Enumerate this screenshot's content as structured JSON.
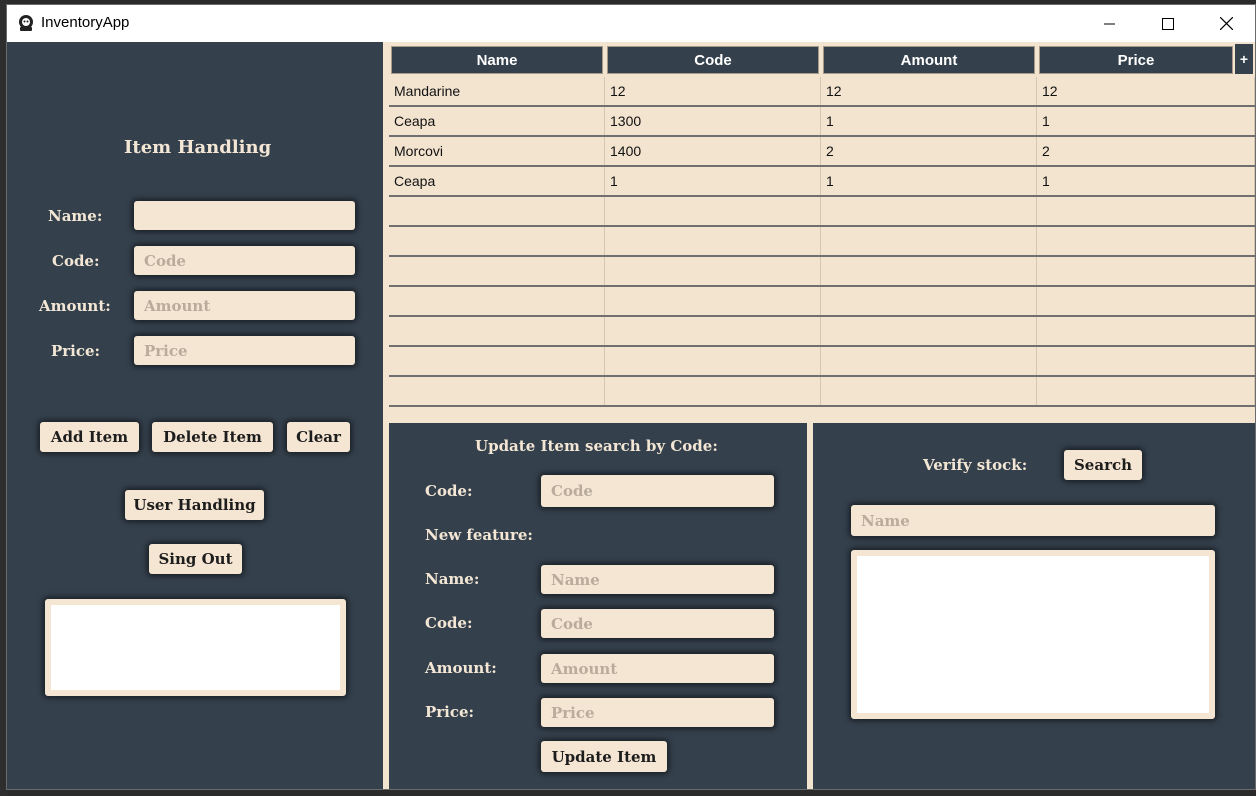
{
  "window": {
    "title": "InventoryApp"
  },
  "item_handling": {
    "heading": "Item Handling",
    "name_label": "Name:",
    "code_label": "Code:",
    "amount_label": "Amount:",
    "price_label": "Price:",
    "name_value": "",
    "code_placeholder": "Code",
    "amount_placeholder": "Amount",
    "price_placeholder": "Price",
    "add_button": "Add Item",
    "delete_button": "Delete Item",
    "clear_button": "Clear",
    "user_handling_button": "User Handling",
    "sign_out_button": "Sing Out"
  },
  "table": {
    "columns": [
      "Name",
      "Code",
      "Amount",
      "Price"
    ],
    "add_column_glyph": "+",
    "rows": [
      [
        "Mandarine",
        "12",
        "12",
        "12"
      ],
      [
        "Ceapa",
        "1300",
        "1",
        "1"
      ],
      [
        "Morcovi",
        "1400",
        "2",
        "2"
      ],
      [
        "Ceapa",
        "1",
        "1",
        "1"
      ],
      [
        "",
        "",
        "",
        ""
      ],
      [
        "",
        "",
        "",
        ""
      ],
      [
        "",
        "",
        "",
        ""
      ],
      [
        "",
        "",
        "",
        ""
      ],
      [
        "",
        "",
        "",
        ""
      ],
      [
        "",
        "",
        "",
        ""
      ],
      [
        "",
        "",
        "",
        ""
      ]
    ]
  },
  "update": {
    "heading": "Update Item search by Code:",
    "code_label": "Code:",
    "code_placeholder": "Code",
    "new_feature_label": "New feature:",
    "name_label": "Name:",
    "name_placeholder": "Name",
    "code2_label": "Code:",
    "code2_placeholder": "Code",
    "amount_label": "Amount:",
    "amount_placeholder": "Amount",
    "price_label": "Price:",
    "price_placeholder": "Price",
    "update_button": "Update Item"
  },
  "verify": {
    "label": "Verify stock:",
    "search_button": "Search",
    "name_placeholder": "Name"
  },
  "colors": {
    "panel_bg": "#34404c",
    "field_bg": "#f5e6d3",
    "label_text": "#f3e6d4"
  }
}
